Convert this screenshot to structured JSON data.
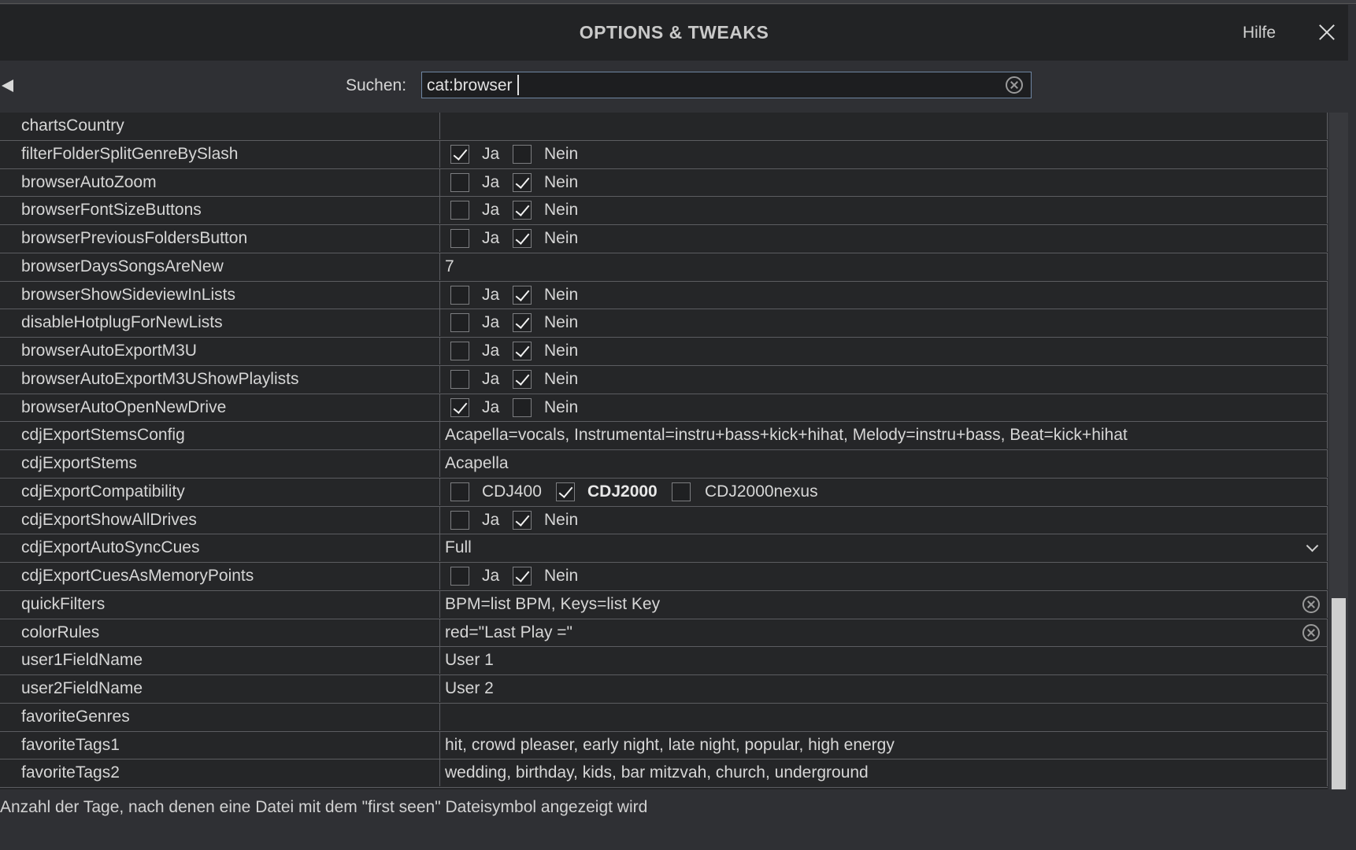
{
  "window": {
    "title": "OPTIONS & TWEAKS",
    "help_label": "Hilfe"
  },
  "search": {
    "label": "Suchen:",
    "value": "cat:browser"
  },
  "settings": [
    {
      "name": "chartsCountry",
      "type": "text",
      "value": ""
    },
    {
      "name": "filterFolderSplitGenreBySlash",
      "type": "yesno",
      "yes_label": "Ja",
      "no_label": "Nein",
      "checked": "yes"
    },
    {
      "name": "browserAutoZoom",
      "type": "yesno",
      "yes_label": "Ja",
      "no_label": "Nein",
      "checked": "no"
    },
    {
      "name": "browserFontSizeButtons",
      "type": "yesno",
      "yes_label": "Ja",
      "no_label": "Nein",
      "checked": "no"
    },
    {
      "name": "browserPreviousFoldersButton",
      "type": "yesno",
      "yes_label": "Ja",
      "no_label": "Nein",
      "checked": "no"
    },
    {
      "name": "browserDaysSongsAreNew",
      "type": "text",
      "value": "7"
    },
    {
      "name": "browserShowSideviewInLists",
      "type": "yesno",
      "yes_label": "Ja",
      "no_label": "Nein",
      "checked": "no"
    },
    {
      "name": "disableHotplugForNewLists",
      "type": "yesno",
      "yes_label": "Ja",
      "no_label": "Nein",
      "checked": "no"
    },
    {
      "name": "browserAutoExportM3U",
      "type": "yesno",
      "yes_label": "Ja",
      "no_label": "Nein",
      "checked": "no"
    },
    {
      "name": "browserAutoExportM3UShowPlaylists",
      "type": "yesno",
      "yes_label": "Ja",
      "no_label": "Nein",
      "checked": "no"
    },
    {
      "name": "browserAutoOpenNewDrive",
      "type": "yesno",
      "yes_label": "Ja",
      "no_label": "Nein",
      "checked": "yes"
    },
    {
      "name": "cdjExportStemsConfig",
      "type": "text",
      "value": "Acapella=vocals, Instrumental=instru+bass+kick+hihat, Melody=instru+bass, Beat=kick+hihat"
    },
    {
      "name": "cdjExportStems",
      "type": "text",
      "value": "Acapella"
    },
    {
      "name": "cdjExportCompatibility",
      "type": "multi",
      "options": [
        {
          "label": "CDJ400",
          "checked": false
        },
        {
          "label": "CDJ2000",
          "checked": true
        },
        {
          "label": "CDJ2000nexus",
          "checked": false
        }
      ]
    },
    {
      "name": "cdjExportShowAllDrives",
      "type": "yesno",
      "yes_label": "Ja",
      "no_label": "Nein",
      "checked": "no"
    },
    {
      "name": "cdjExportAutoSyncCues",
      "type": "dropdown",
      "value": "Full"
    },
    {
      "name": "cdjExportCuesAsMemoryPoints",
      "type": "yesno",
      "yes_label": "Ja",
      "no_label": "Nein",
      "checked": "no"
    },
    {
      "name": "quickFilters",
      "type": "clearable",
      "value": "BPM=list BPM, Keys=list Key"
    },
    {
      "name": "colorRules",
      "type": "clearable",
      "value": "red=\"Last Play =\""
    },
    {
      "name": "user1FieldName",
      "type": "text",
      "value": "User 1"
    },
    {
      "name": "user2FieldName",
      "type": "text",
      "value": "User 2"
    },
    {
      "name": "favoriteGenres",
      "type": "text",
      "value": ""
    },
    {
      "name": "favoriteTags1",
      "type": "text",
      "value": "hit, crowd pleaser, early night, late night, popular, high energy"
    },
    {
      "name": "favoriteTags2",
      "type": "text",
      "value": "wedding, birthday, kids, bar mitzvah, church, underground"
    }
  ],
  "footer": {
    "description": "Anzahl der Tage, nach denen eine Datei mit dem \"first seen\"  Dateisymbol angezeigt wird"
  }
}
